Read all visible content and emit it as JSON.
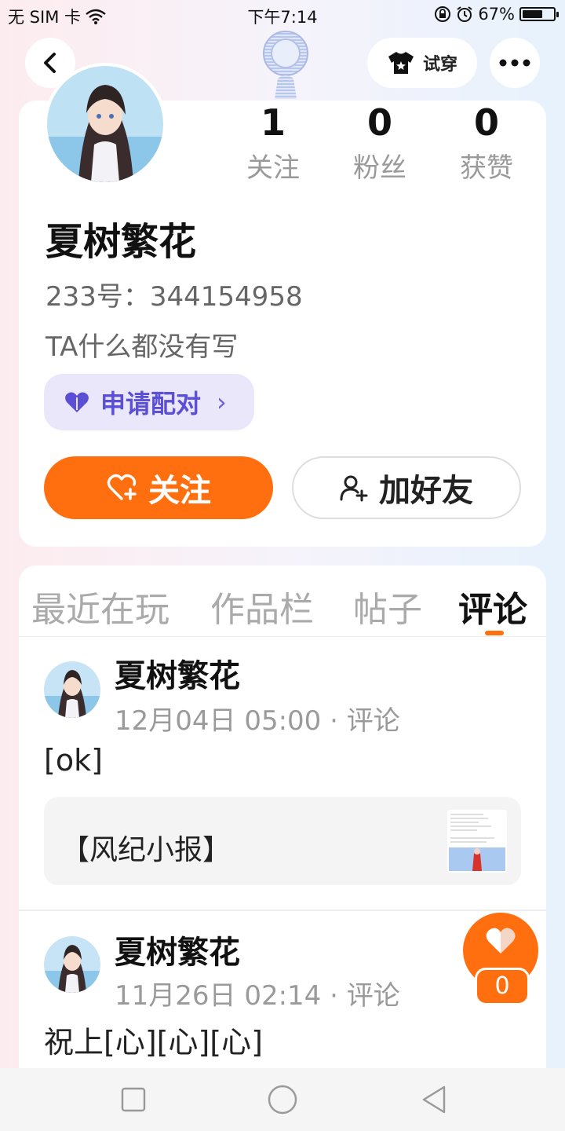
{
  "status_bar": {
    "carrier": "无 SIM 卡",
    "time": "下午7:14",
    "battery_percent": "67%",
    "battery_level": 0.67
  },
  "header": {
    "tryon_label": "试穿"
  },
  "profile": {
    "name": "夏树繁花",
    "uid": "233号：344154958",
    "bio": "TA什么都没有写",
    "stats": [
      {
        "num": "1",
        "label": "关注"
      },
      {
        "num": "0",
        "label": "粉丝"
      },
      {
        "num": "0",
        "label": "获赞"
      }
    ],
    "pair_label": "申请配对",
    "pair_chevron": "›",
    "follow_label": "关注",
    "add_friend_label": "加好友"
  },
  "tabs": [
    {
      "label": "最近在玩"
    },
    {
      "label": "作品栏"
    },
    {
      "label": "帖子"
    },
    {
      "label": "评论"
    }
  ],
  "posts": [
    {
      "name": "夏树繁花",
      "meta": "12月04日 05:00 · 评论",
      "text": "[ok]",
      "quote": "【风纪小报】"
    },
    {
      "name": "夏树繁花",
      "meta": "11月26日 02:14 · 评论",
      "text": "祝上[心][心][心]"
    }
  ],
  "like_float": {
    "count": "0"
  },
  "colors": {
    "accent": "#ff6f0f",
    "pair_bg": "#ebe7fb",
    "pair_text": "#5b4fd6"
  }
}
